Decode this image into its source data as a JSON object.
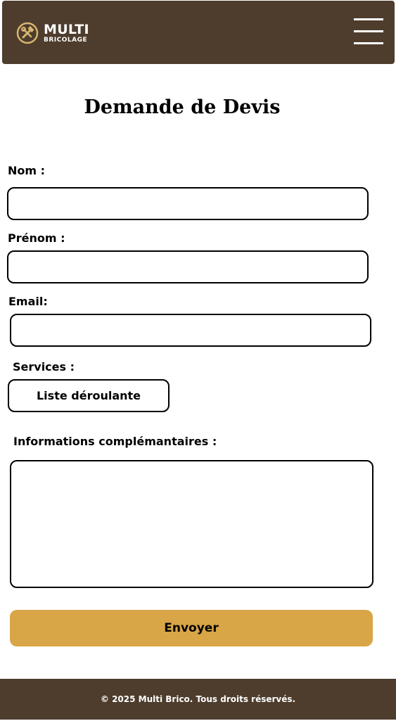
{
  "header": {
    "logo_main": "MULTI",
    "logo_sub": "BRICOLAGE",
    "logo_icon": "tools-icon",
    "menu_icon": "hamburger-menu-icon"
  },
  "page": {
    "title": "Demande de Devis"
  },
  "form": {
    "nom_label": "Nom :",
    "nom_value": "",
    "prenom_label": "Prénom :",
    "prenom_value": "",
    "email_label": "Email:",
    "email_value": "",
    "services_label": "Services :",
    "services_selected": "Liste déroulante",
    "info_label": "Informations complémantaires :",
    "info_value": "",
    "submit_label": "Envoyer"
  },
  "footer": {
    "text": "© 2025 Multi Brico. Tous droits réservés."
  },
  "colors": {
    "header_bg": "#4e3d2d",
    "accent": "#d8a646",
    "logo_gold": "#d7b66e"
  }
}
